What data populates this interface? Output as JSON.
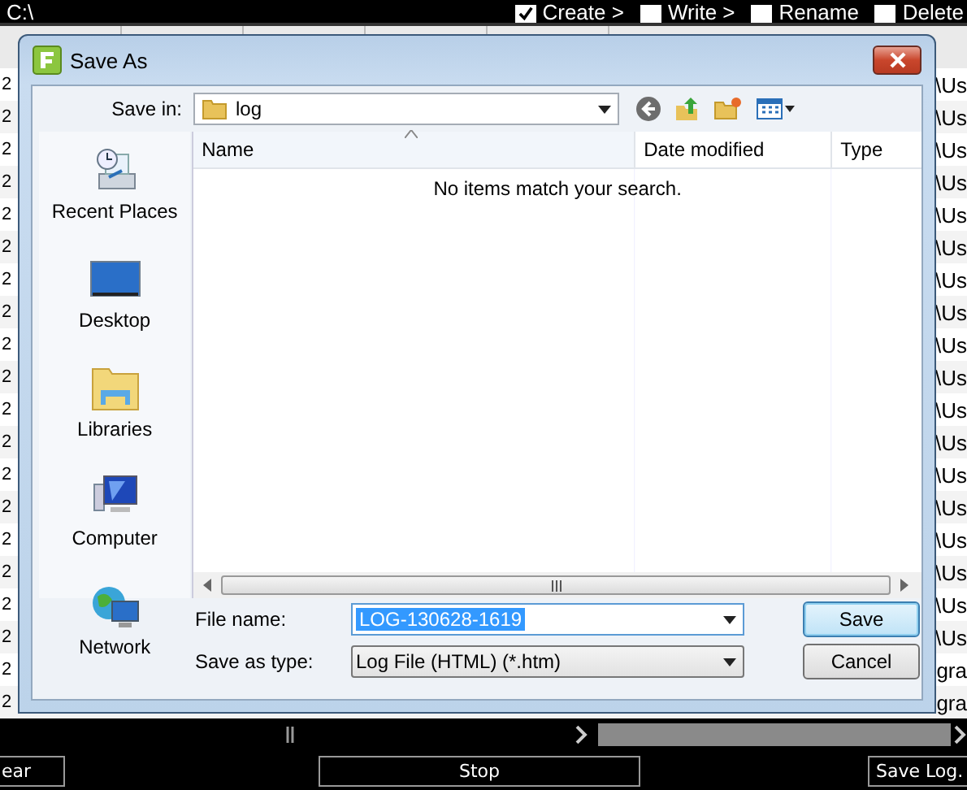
{
  "app": {
    "path": "C:\\",
    "options": [
      {
        "label": "Create >",
        "checked": true
      },
      {
        "label": "Write >",
        "checked": false
      },
      {
        "label": "Rename",
        "checked": false
      },
      {
        "label": "Delete",
        "checked": false
      }
    ],
    "rows": [
      {
        "column_1": "2",
        "column_2": "\\Us"
      },
      {
        "column_1": "2",
        "column_2": "\\Us"
      },
      {
        "column_1": "2",
        "column_2": "\\Us"
      },
      {
        "column_1": "2",
        "column_2": "\\Us"
      },
      {
        "column_1": "2",
        "column_2": "\\Us"
      },
      {
        "column_1": "2",
        "column_2": "\\Us"
      },
      {
        "column_1": "2",
        "column_2": "\\Us"
      },
      {
        "column_1": "2",
        "column_2": "\\Us"
      },
      {
        "column_1": "2",
        "column_2": "\\Us"
      },
      {
        "column_1": "2",
        "column_2": "\\Us"
      },
      {
        "column_1": "2",
        "column_2": "\\Us"
      },
      {
        "column_1": "2",
        "column_2": "\\Us"
      },
      {
        "column_1": "2",
        "column_2": "\\Us"
      },
      {
        "column_1": "2",
        "column_2": "\\Us"
      },
      {
        "column_1": "2",
        "column_2": "\\Us"
      },
      {
        "column_1": "2",
        "column_2": "\\Us"
      },
      {
        "column_1": "2",
        "column_2": "\\Us"
      },
      {
        "column_1": "2",
        "column_2": "\\Us"
      },
      {
        "column_1": "2",
        "column_2": "gra"
      },
      {
        "column_1": "2",
        "column_2": "gra"
      }
    ],
    "buttons": [
      "ear",
      "Stop",
      "Save Log."
    ]
  },
  "dialog": {
    "title": "Save As",
    "save_in_label": "Save in:",
    "save_in": "log",
    "places": [
      {
        "label": "Recent Places",
        "kind": "recent"
      },
      {
        "label": "Desktop",
        "kind": "desktop"
      },
      {
        "label": "Libraries",
        "kind": "libraries"
      },
      {
        "label": "Computer",
        "kind": "computer"
      },
      {
        "label": "Network",
        "kind": "network"
      }
    ],
    "columns": [
      "Name",
      "Date modified",
      "Type"
    ],
    "empty_message": "No items match your search.",
    "file_name_label": "File name:",
    "file_name": "LOG-130628-1619",
    "type_label": "Save as type:",
    "type": "Log File (HTML) (*.htm)",
    "buttons": [
      "Save",
      "Cancel"
    ]
  }
}
